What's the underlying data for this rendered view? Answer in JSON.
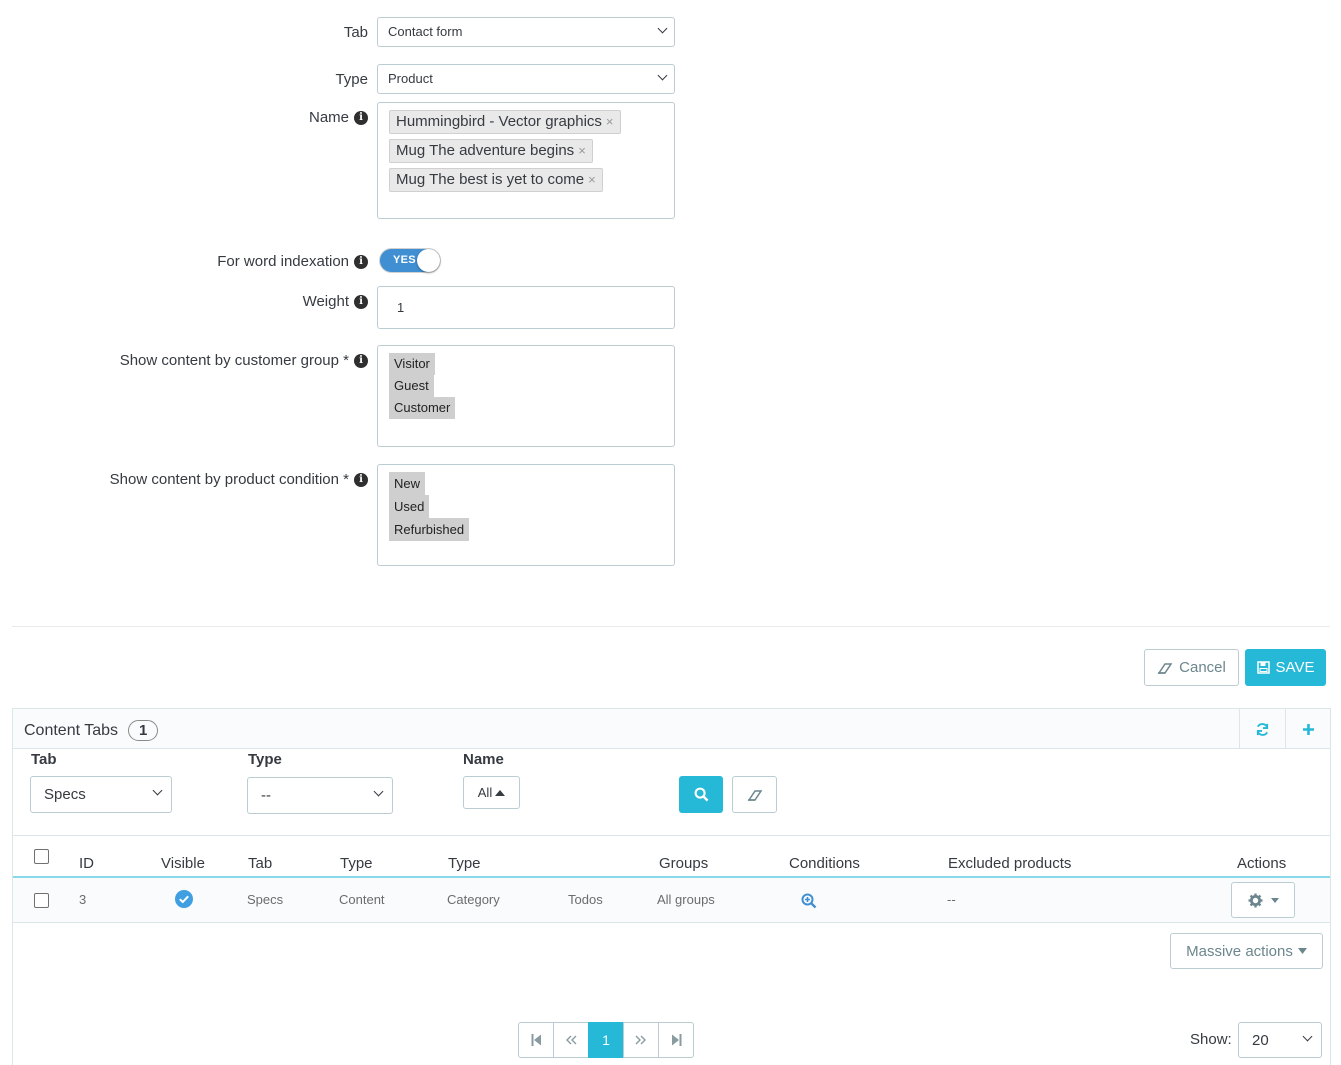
{
  "form": {
    "tab": {
      "label": "Tab",
      "value": "Contact form"
    },
    "type": {
      "label": "Type",
      "value": "Product"
    },
    "name": {
      "label": "Name",
      "tags": [
        "Hummingbird - Vector graphics",
        "Mug The adventure begins",
        "Mug The best is yet to come"
      ],
      "remove_glyph": "×"
    },
    "indexation": {
      "label": "For word indexation",
      "toggle_text": "YES"
    },
    "weight": {
      "label": "Weight",
      "value": "1"
    },
    "groups": {
      "label": "Show content by customer group *",
      "options": [
        "Visitor",
        "Guest",
        "Customer"
      ]
    },
    "conditions": {
      "label": "Show content by product condition *",
      "options": [
        "New",
        "Used",
        "Refurbished"
      ]
    }
  },
  "actions": {
    "cancel": "Cancel",
    "save": "SAVE"
  },
  "panel": {
    "title": "Content Tabs",
    "count": "1",
    "filters": {
      "tab": {
        "label": "Tab",
        "value": "Specs"
      },
      "type": {
        "label": "Type",
        "value": "--"
      },
      "name": {
        "label": "Name",
        "value": "All"
      }
    },
    "columns": [
      "ID",
      "Visible",
      "Tab",
      "Type",
      "Type",
      "Groups",
      "Conditions",
      "Excluded products",
      "Actions"
    ],
    "rows": [
      {
        "id": "3",
        "tab": "Specs",
        "type": "Content",
        "type2": "Category",
        "type3": "Todos",
        "groups": "All groups",
        "excluded": "--"
      }
    ],
    "massive_actions": "Massive actions",
    "pagination": {
      "current": "1"
    },
    "show": {
      "label": "Show:",
      "value": "20"
    }
  },
  "colors": {
    "accent": "#25b9d7",
    "toggle": "#3f8fd2",
    "border": "#bbcdd2"
  }
}
